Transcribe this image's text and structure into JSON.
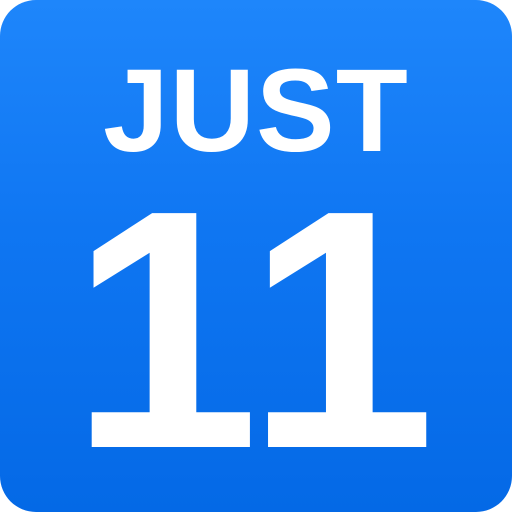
{
  "icon": {
    "top_text": "JUST",
    "big_text": "11",
    "background_color_top": "#1e86fb",
    "background_color_bottom": "#0469e6",
    "text_color": "#ffffff"
  }
}
